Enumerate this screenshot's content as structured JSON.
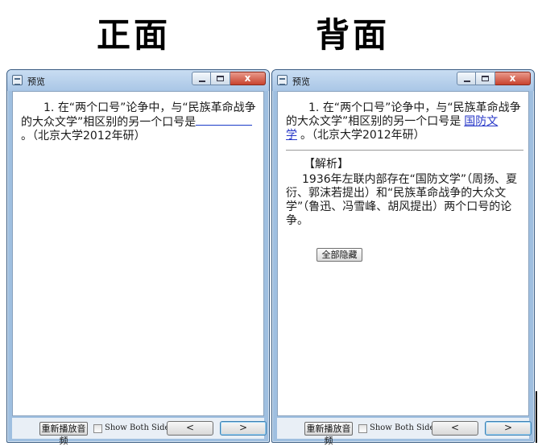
{
  "titles": {
    "front": "正面",
    "back": "背面"
  },
  "windows": {
    "front": {
      "title": "预览",
      "question": {
        "number": "1.",
        "before_blank": "在“两个口号”论争中，与“民族革命战争的大众文学”相区别的另一个口号是",
        "after_blank": "。（北京大学2012年研）"
      }
    },
    "back": {
      "title": "预览",
      "question": {
        "number": "1.",
        "before_blank": "在“两个口号”论争中，与“民族革命战争的大众文学”相区别的另一个口号是",
        "answer": "国防文学",
        "after_blank": "。（北京大学2012年研）"
      },
      "analysis": {
        "heading": "【解析】",
        "body": "1936年左联内部存在“国防文学”（周扬、夏衍、郭沫若提出）和“民族革命战争的大众文学”（鲁迅、冯雪峰、胡风提出）两个口号的论争。"
      },
      "hide_all_label": "全部隐藏"
    }
  },
  "toolbar": {
    "replay_label": "重新播放音频",
    "show_both_label": "Show Both Sides",
    "prev_label": "<",
    "next_label": ">"
  },
  "caption_buttons": {
    "close_glyph": "x"
  }
}
